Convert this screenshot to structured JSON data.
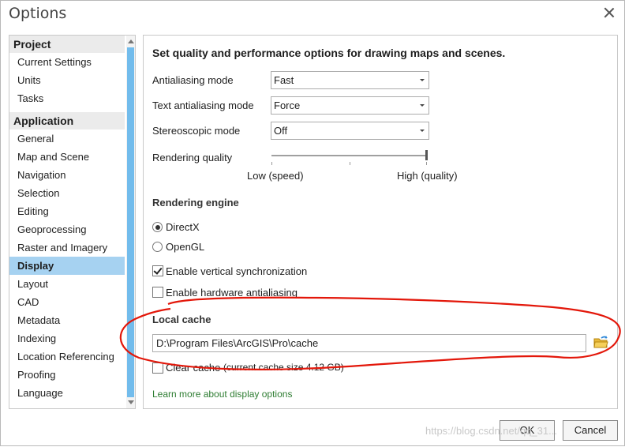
{
  "window": {
    "title": "Options"
  },
  "sidebar": {
    "groups": [
      {
        "label": "Project",
        "items": [
          "Current Settings",
          "Units",
          "Tasks"
        ]
      },
      {
        "label": "Application",
        "items": [
          "General",
          "Map and Scene",
          "Navigation",
          "Selection",
          "Editing",
          "Geoprocessing",
          "Raster and Imagery",
          "Display",
          "Layout",
          "CAD",
          "Metadata",
          "Indexing",
          "Location Referencing",
          "Proofing",
          "Language"
        ]
      }
    ],
    "selected": "Display"
  },
  "panel": {
    "heading": "Set quality and performance options for drawing maps and scenes.",
    "antialiasing_label": "Antialiasing mode",
    "antialiasing_value": "Fast",
    "text_antialiasing_label": "Text antialiasing mode",
    "text_antialiasing_value": "Force",
    "stereo_label": "Stereoscopic mode",
    "stereo_value": "Off",
    "rendering_quality_label": "Rendering quality",
    "rendering_quality_level": 1.0,
    "slider_low": "Low (speed)",
    "slider_high": "High (quality)",
    "engine_heading": "Rendering engine",
    "engine_directx": "DirectX",
    "engine_opengl": "OpenGL",
    "vsync_label": "Enable vertical synchronization",
    "vsync_checked": true,
    "hw_aa_label": "Enable hardware antialiasing",
    "hw_aa_checked": false,
    "cache_heading": "Local cache",
    "cache_path": "D:\\Program Files\\ArcGIS\\Pro\\cache",
    "clear_cache_label": "Clear cache",
    "cache_size": "(current cache size 4.12 GB)",
    "learn_more": "Learn more about display options"
  },
  "buttons": {
    "ok": "OK",
    "cancel": "Cancel"
  },
  "watermark": "https://blog.csdn.net/qq_31...",
  "colors": {
    "selection": "#a6d2f1",
    "scroll_thumb": "#72bcec",
    "annotation": "#e3170a",
    "link": "#2e7d32"
  }
}
